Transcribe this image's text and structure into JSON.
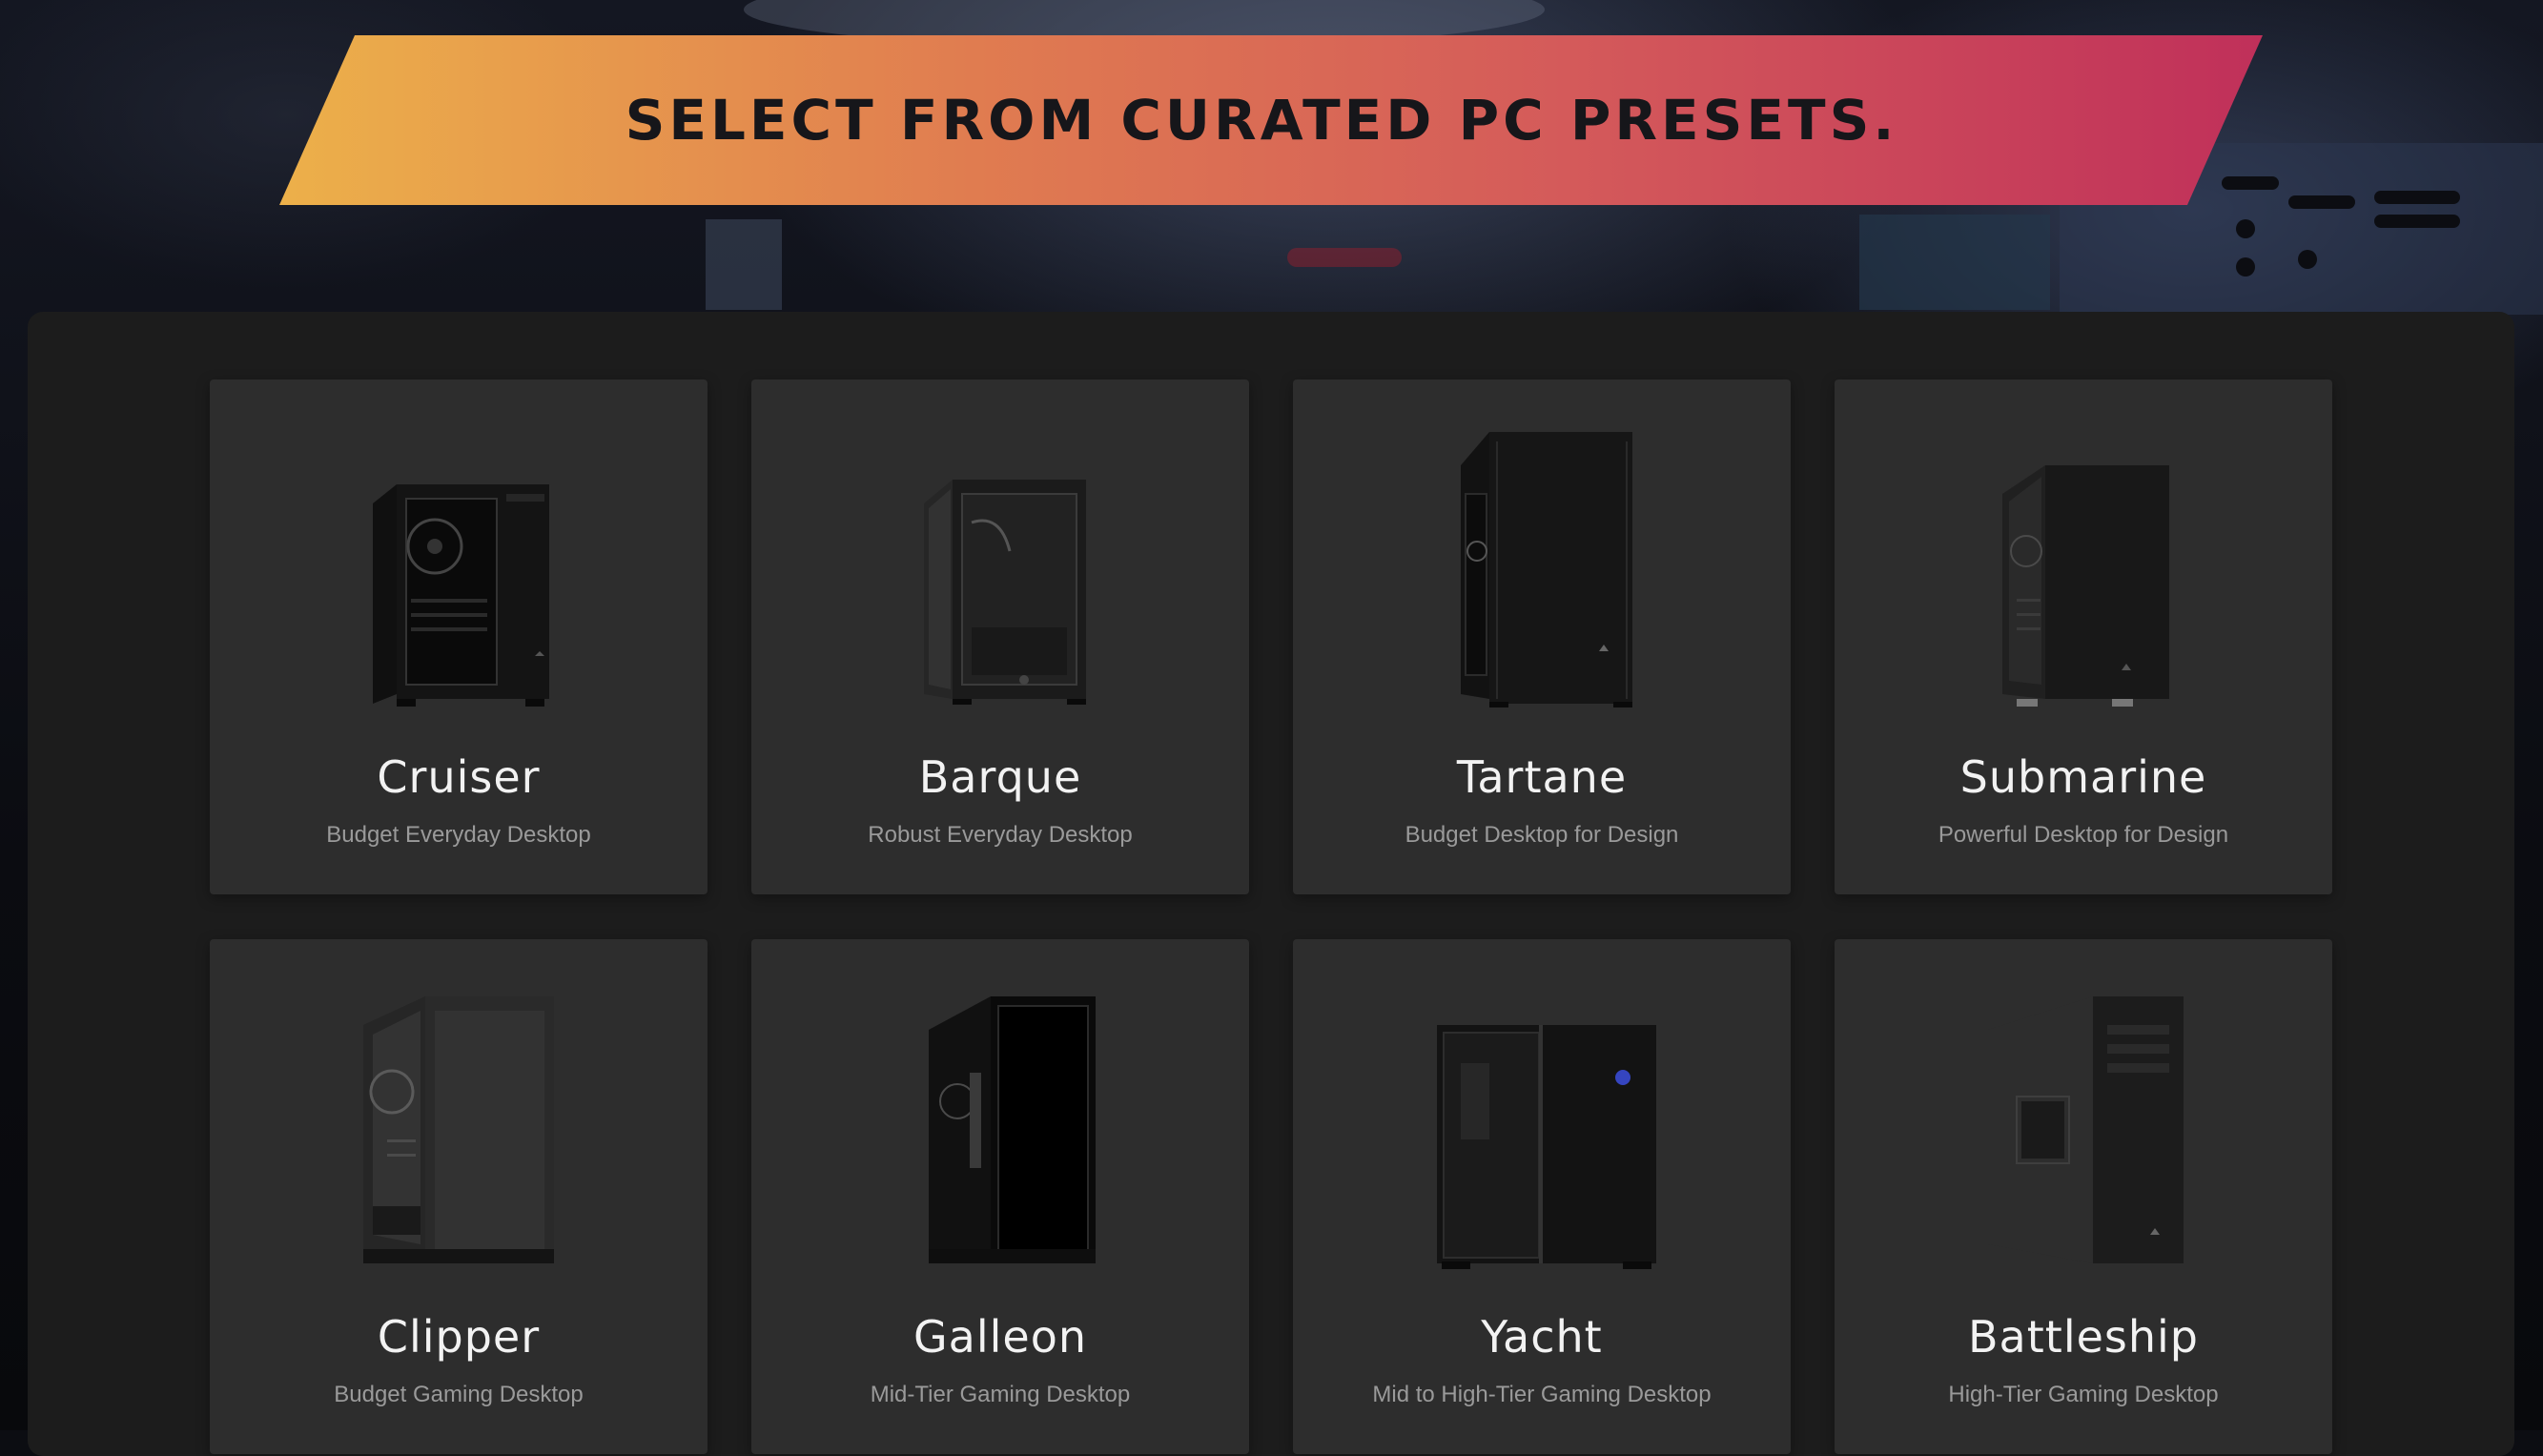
{
  "header": {
    "title": "SELECT FROM CURATED PC PRESETS."
  },
  "colors": {
    "banner_start": "#ecb04a",
    "banner_end": "#c0305a",
    "panel": "#1c1c1c",
    "card": "#2d2d2d"
  },
  "presets": [
    {
      "name": "Cruiser",
      "description": "Budget Everyday Desktop",
      "icon": "pc-case-icon"
    },
    {
      "name": "Barque",
      "description": "Robust Everyday Desktop",
      "icon": "pc-case-icon"
    },
    {
      "name": "Tartane",
      "description": "Budget Desktop for Design",
      "icon": "pc-case-icon"
    },
    {
      "name": "Submarine",
      "description": "Powerful Desktop for Design",
      "icon": "pc-case-icon"
    },
    {
      "name": "Clipper",
      "description": "Budget Gaming Desktop",
      "icon": "pc-case-icon"
    },
    {
      "name": "Galleon",
      "description": "Mid-Tier Gaming Desktop",
      "icon": "pc-case-icon"
    },
    {
      "name": "Yacht",
      "description": "Mid to High-Tier Gaming Desktop",
      "icon": "pc-case-icon"
    },
    {
      "name": "Battleship",
      "description": "High-Tier Gaming Desktop",
      "icon": "pc-case-icon"
    }
  ]
}
